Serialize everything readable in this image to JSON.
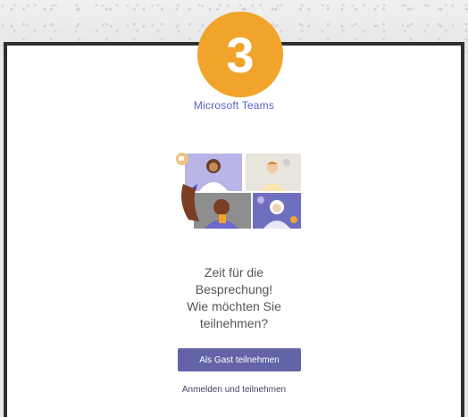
{
  "badge": {
    "number": "3",
    "color": "#f1a42b"
  },
  "header": {
    "app_name": "Microsoft Teams"
  },
  "illustration": {
    "icon": "teams-meeting-people-illustration"
  },
  "prompt": {
    "lines": [
      "Zeit für die",
      "Besprechung!",
      "Wie möchten Sie",
      "teilnehmen?"
    ]
  },
  "actions": {
    "guest_button": "Als Gast teilnehmen",
    "signin_link": "Anmelden und teilnehmen"
  },
  "colors": {
    "accent": "#6264a7",
    "frame": "#2f2f2f"
  }
}
